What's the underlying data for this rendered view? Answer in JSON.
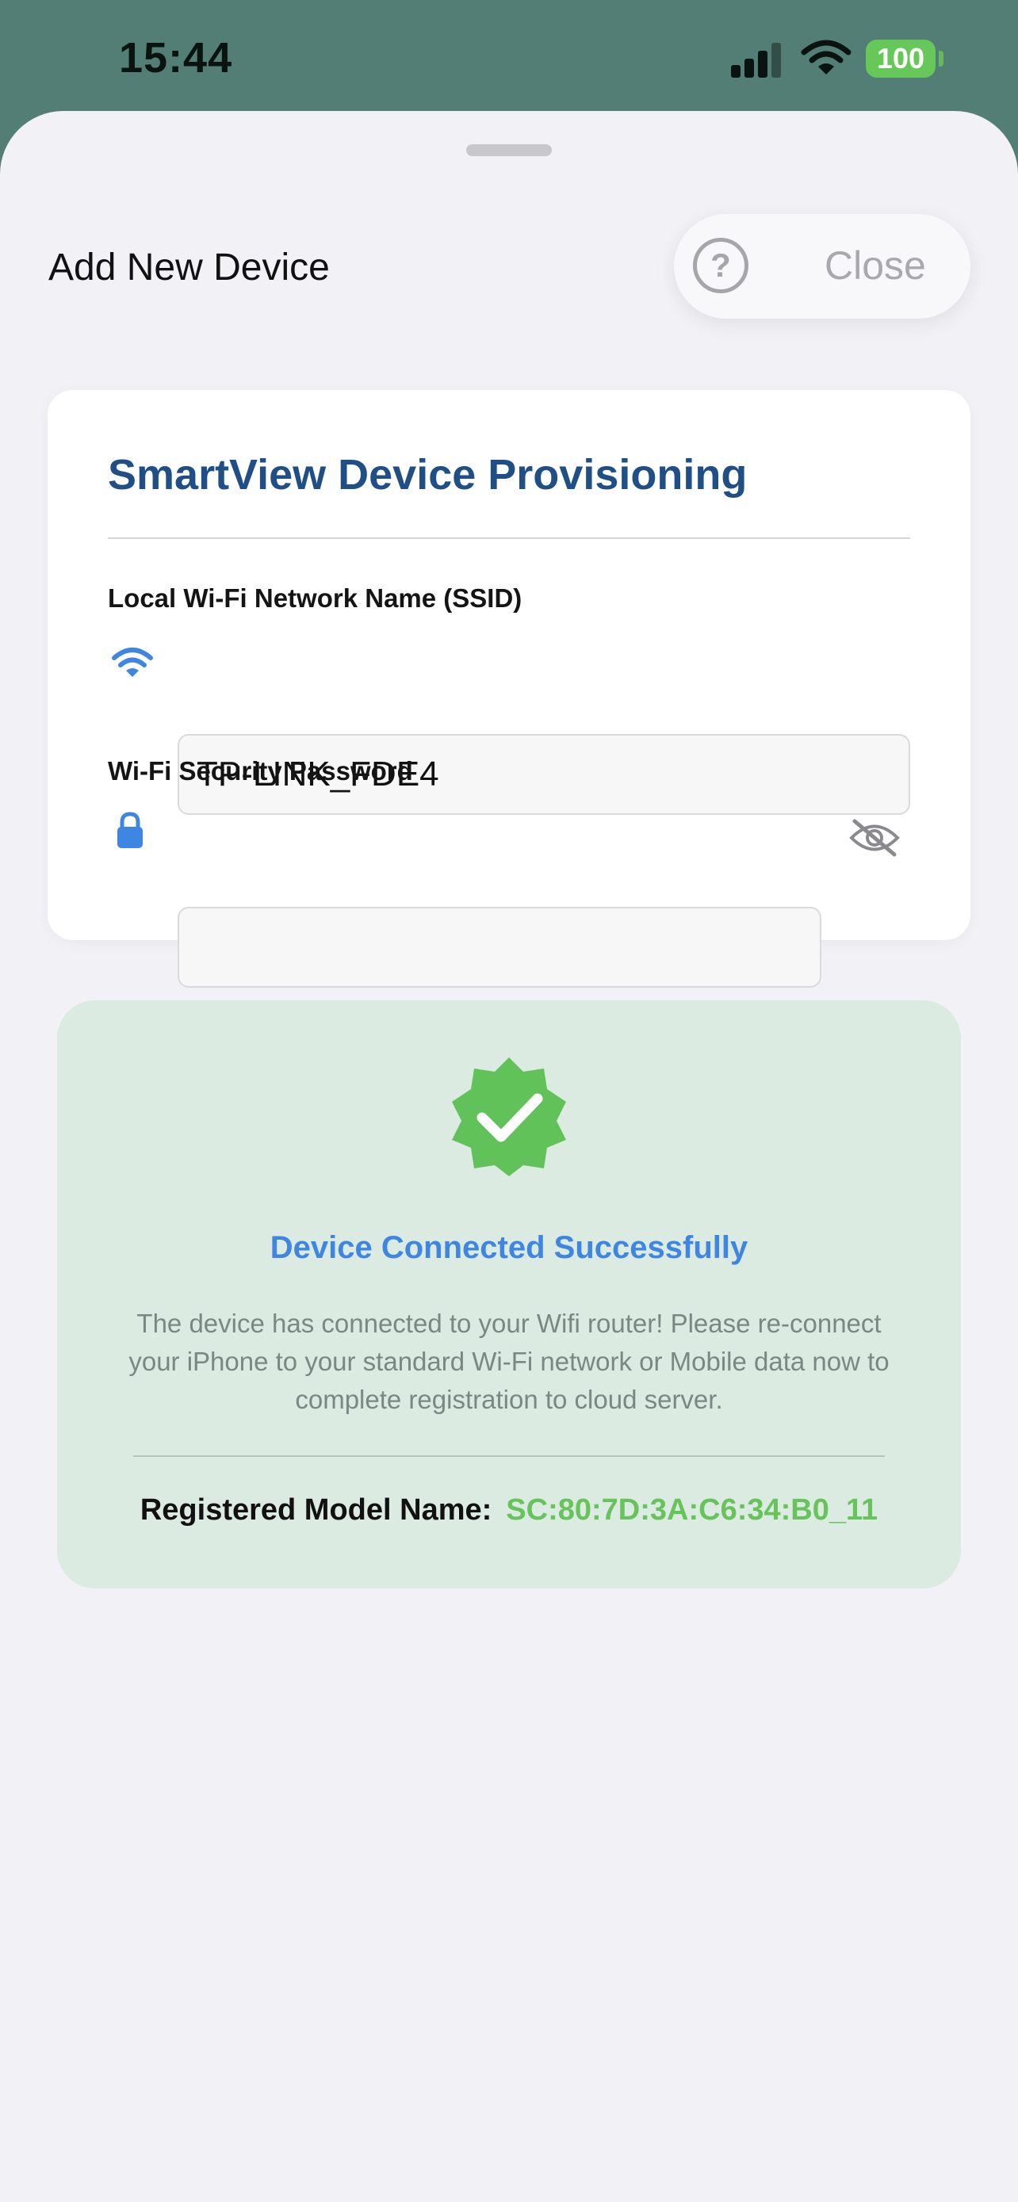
{
  "status_bar": {
    "time": "15:44",
    "battery": "100"
  },
  "sheet": {
    "title": "Add New Device",
    "help_icon": "?",
    "close_label": "Close"
  },
  "form": {
    "title": "SmartView Device Provisioning",
    "ssid_label": "Local Wi-Fi Network Name (SSID)",
    "ssid_value": "TP-LINK_FDE4",
    "password_label": "Wi-Fi Security Password",
    "password_value": ""
  },
  "success": {
    "title": "Device Connected Successfully",
    "description": "The device has connected to your Wifi router! Please re-connect your iPhone to your standard Wi-Fi network or Mobile data now to complete registration to cloud server.",
    "model_label": "Registered Model Name:",
    "model_value": "SC:80:7D:3A:C6:34:B0_11"
  },
  "colors": {
    "accent_blue": "#3f86e3",
    "title_navy": "#1f4f86",
    "success_green": "#66c45a",
    "success_bg": "#dbebe1",
    "header_teal": "#527e76"
  },
  "icons": [
    "cellular-signal-icon",
    "wifi-status-icon",
    "battery-icon",
    "help-icon",
    "wifi-icon",
    "lock-icon",
    "eye-slash-icon",
    "verified-badge-icon"
  ]
}
